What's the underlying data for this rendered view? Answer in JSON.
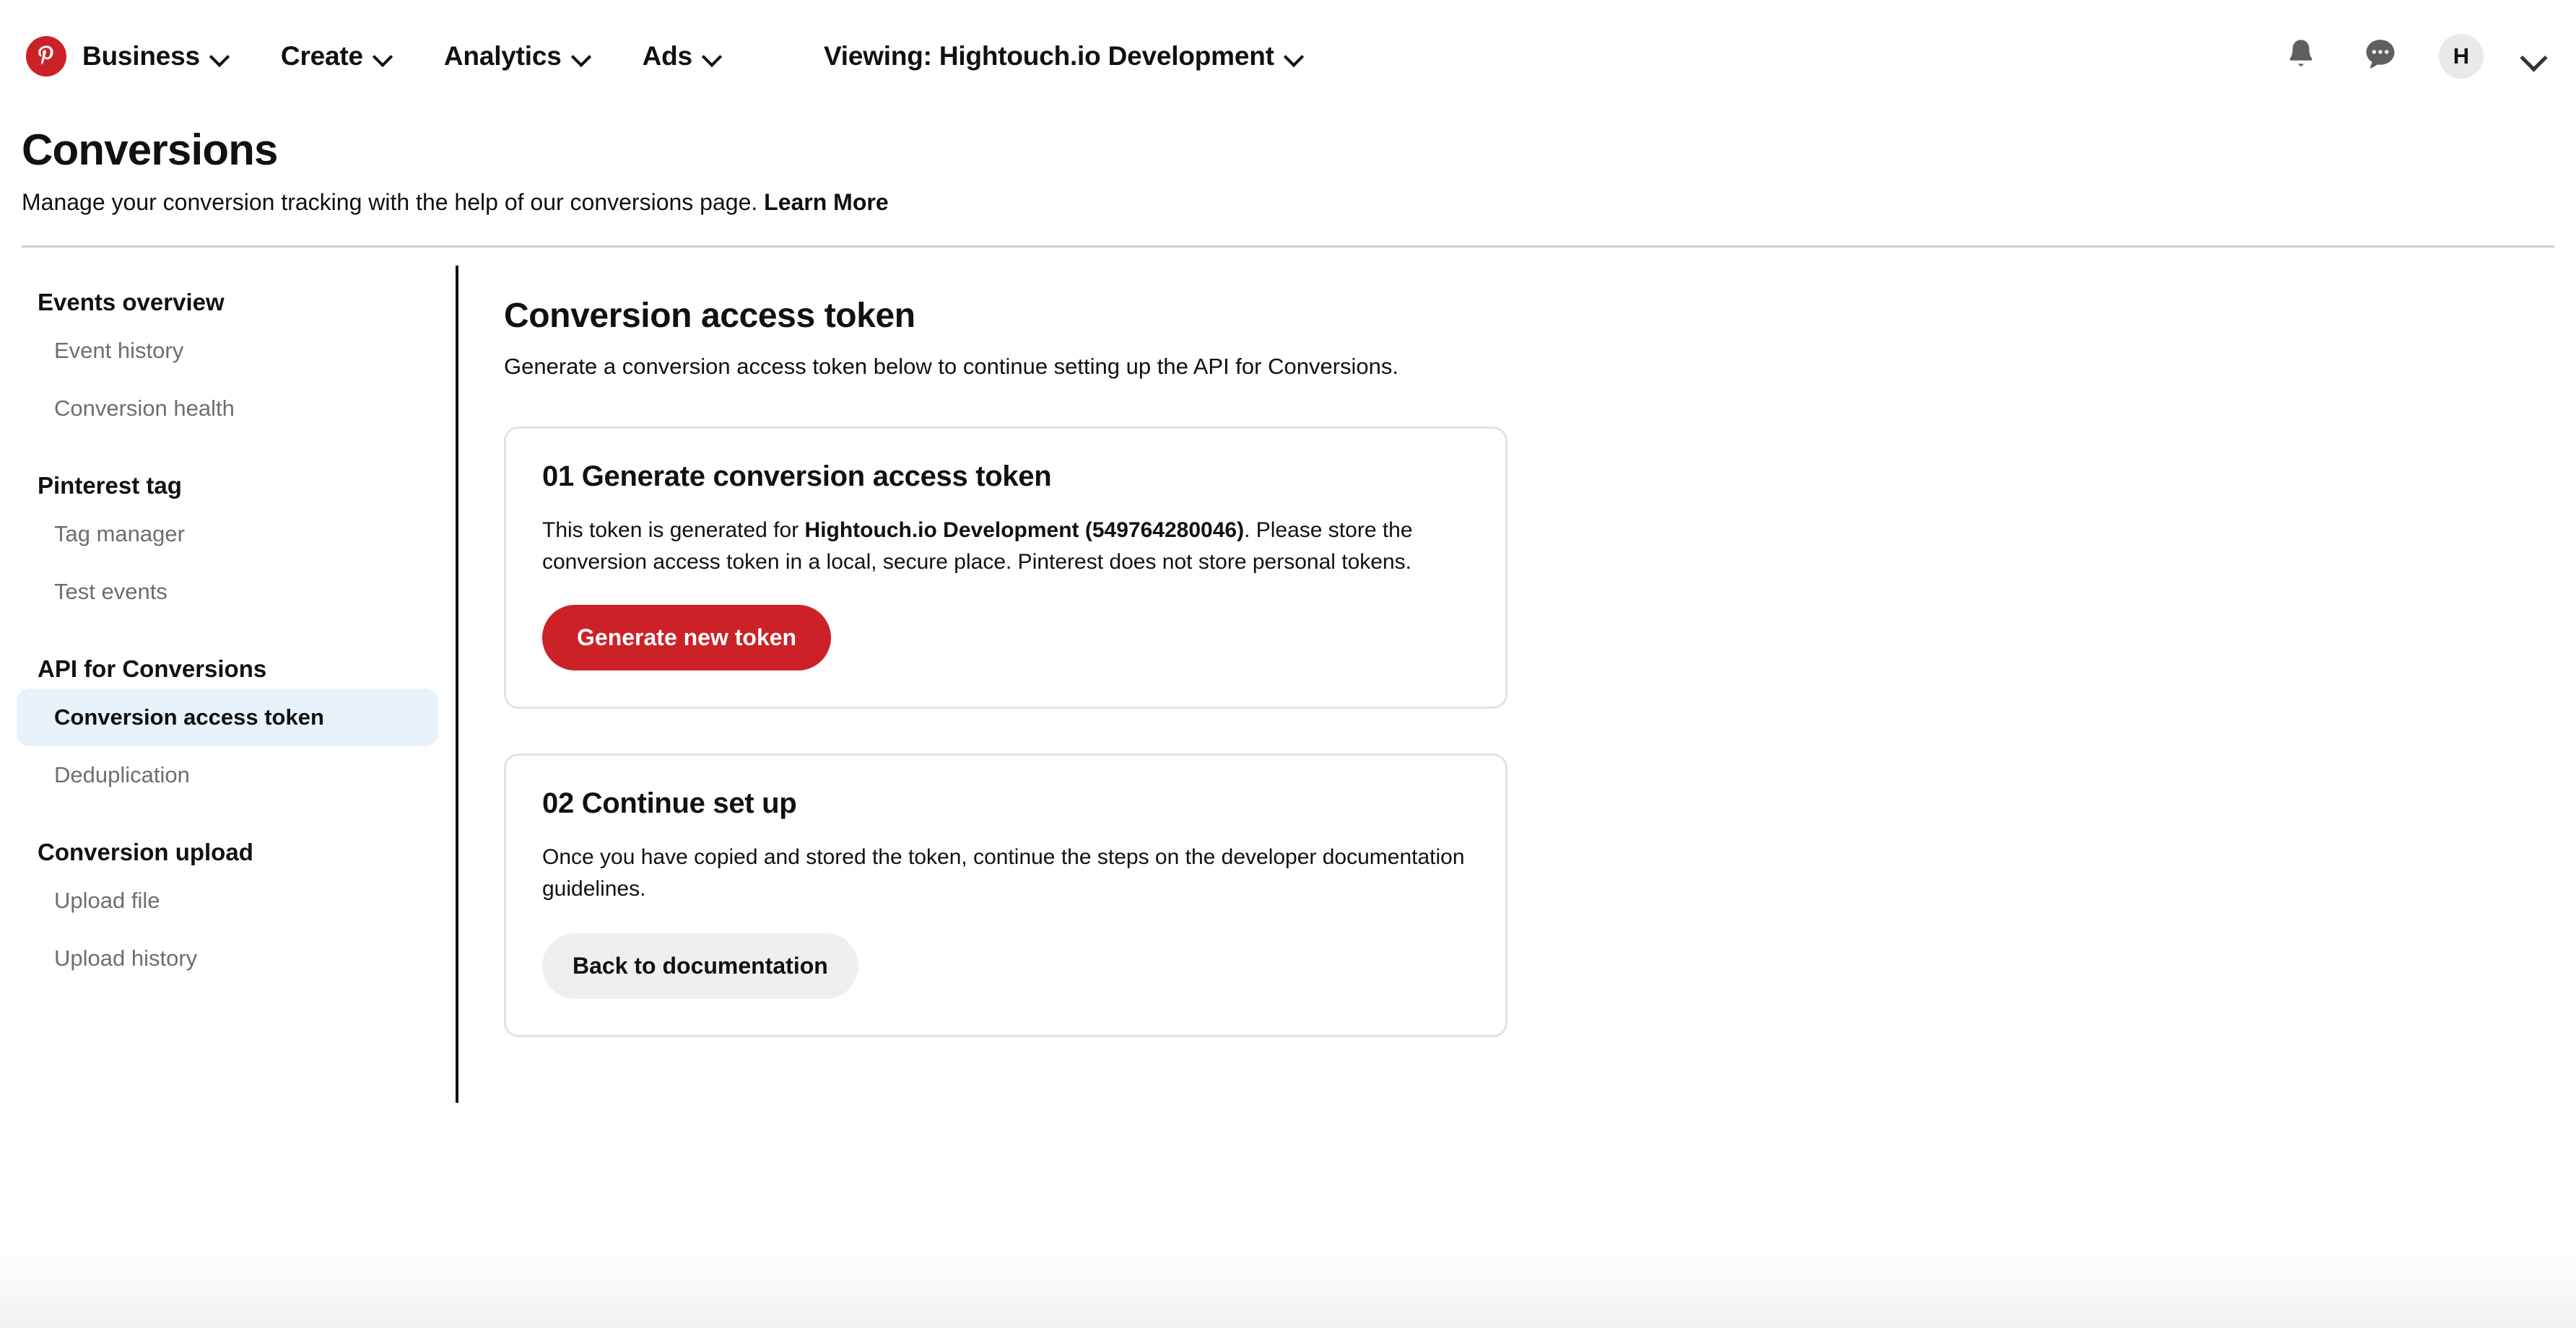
{
  "topnav": {
    "logo_icon": "pinterest-logo-icon",
    "items": [
      {
        "label": "Business",
        "icon": "chevron-down-icon"
      },
      {
        "label": "Create",
        "icon": "chevron-down-icon"
      },
      {
        "label": "Analytics",
        "icon": "chevron-down-icon"
      },
      {
        "label": "Ads",
        "icon": "chevron-down-icon"
      },
      {
        "label": "Viewing: Hightouch.io Development",
        "icon": "chevron-down-icon"
      }
    ],
    "right": {
      "notifications_icon": "bell-icon",
      "messages_icon": "speech-bubble-ellipsis-icon",
      "avatar_initial": "H",
      "account_menu_icon": "chevron-down-icon"
    }
  },
  "header": {
    "title": "Conversions",
    "subtitle": "Manage your conversion tracking with the help of our conversions page.",
    "learn_more": "Learn More"
  },
  "sidebar": {
    "groups": [
      {
        "title": "Events overview",
        "links": [
          {
            "label": "Event history",
            "active": false
          },
          {
            "label": "Conversion health",
            "active": false
          }
        ]
      },
      {
        "title": "Pinterest tag",
        "links": [
          {
            "label": "Tag manager",
            "active": false
          },
          {
            "label": "Test events",
            "active": false
          }
        ]
      },
      {
        "title": "API for Conversions",
        "links": [
          {
            "label": "Conversion access token",
            "active": true
          },
          {
            "label": "Deduplication",
            "active": false
          }
        ]
      },
      {
        "title": "Conversion upload",
        "links": [
          {
            "label": "Upload file",
            "active": false
          },
          {
            "label": "Upload history",
            "active": false
          }
        ]
      }
    ],
    "active_background": "#e7f2fb"
  },
  "main": {
    "title": "Conversion access token",
    "subtitle": "Generate a conversion access token below to continue setting up the API for Conversions.",
    "cards": [
      {
        "title": "01 Generate conversion access token",
        "body_before": "This token is generated for ",
        "body_bold": "Hightouch.io Development (549764280046)",
        "body_after": ". Please store the conversion access token in a local, secure place. Pinterest does not store personal tokens.",
        "account_name": "Hightouch.io Development",
        "account_id": "549764280046",
        "button_label": "Generate new token",
        "button_color": "#cc2127"
      },
      {
        "title": "02 Continue set up",
        "body": "Once you have copied and stored the token, continue the steps on the developer documentation guidelines.",
        "button_label": "Back to documentation",
        "button_color": "#efefef"
      }
    ]
  }
}
